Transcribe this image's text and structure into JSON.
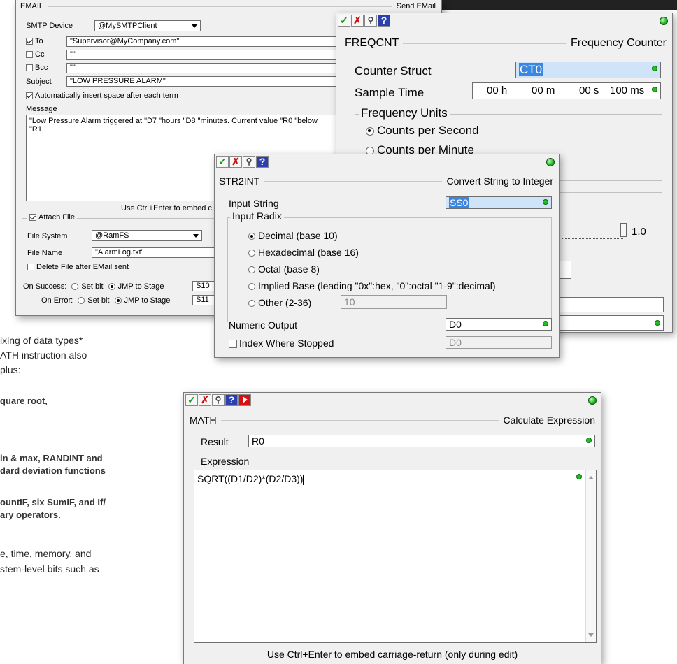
{
  "toolbar_icons": [
    "check-icon",
    "x-icon",
    "search-icon",
    "help-icon"
  ],
  "toolbar_glyphs": {
    "ok": "✓",
    "cancel": "✗",
    "find": "⚲",
    "help": "?"
  },
  "email": {
    "section_title": "EMAIL",
    "section_right": "Send EMail",
    "smtp_label": "SMTP Device",
    "smtp_value": "@MySMTPClient",
    "to_label": "To",
    "to_value": "\"Supervisor@MyCompany.com\"",
    "cc_label": "Cc",
    "cc_value": "\"\"",
    "bcc_label": "Bcc",
    "bcc_value": "\"\"",
    "subject_label": "Subject",
    "subject_value": "\"LOW PRESSURE ALARM\"",
    "auto_space_label": "Automatically insert space after each term",
    "message_label": "Message",
    "message_line1": "\"Low Pressure Alarm triggered at \"D7 \"hours \"D8 \"minutes. Current value \"R0 \"below",
    "message_line2": "\"R1",
    "hint": "Use Ctrl+Enter to embed c",
    "attach_label": "Attach File",
    "fs_label": "File System",
    "fs_value": "@RamFS",
    "fname_label": "File Name",
    "fname_value": "\"AlarmLog.txt\"",
    "delete_label": "Delete File after EMail sent",
    "success_label": "On Success:",
    "error_label": "On Error:",
    "setbit_label": "Set bit",
    "jmp_label": "JMP to Stage",
    "success_stage": "S10",
    "error_stage": "S11"
  },
  "freqcnt": {
    "name": "FREQCNT",
    "title": "Frequency Counter",
    "struct_label": "Counter Struct",
    "struct_value": "CT0",
    "sample_label": "Sample Time",
    "h": "00 h",
    "m": "00 m",
    "s": "00 s",
    "ms": "100 ms",
    "units_label": "Frequency Units",
    "unit_sec": "Counts per Second",
    "unit_min": "Counts per Minute",
    "slider_value": "1.0"
  },
  "str2int": {
    "name": "STR2INT",
    "title": "Convert String to Integer",
    "input_label": "Input String",
    "input_value": "SS0",
    "radix_label": "Input Radix",
    "r_dec": "Decimal (base 10)",
    "r_hex": "Hexadecimal (base 16)",
    "r_oct": "Octal (base 8)",
    "r_impl": "Implied Base (leading \"0x\":hex, \"0\":octal \"1-9\":decimal)",
    "r_other": "Other (2-36)",
    "other_value": "10",
    "output_label": "Numeric Output",
    "output_value": "D0",
    "index_label": "Index Where Stopped",
    "index_value": "D0"
  },
  "math": {
    "name": "MATH",
    "title": "Calculate Expression",
    "result_label": "Result",
    "result_value": "R0",
    "expr_label": "Expression",
    "expr_value": "SQRT((D1/D2)*(D2/D3))",
    "hint": "Use Ctrl+Enter to embed carriage-return (only during edit)"
  },
  "background_text": {
    "l1": "ixing of data types*",
    "l2": "ATH instruction also",
    "l3": "plus:",
    "l4": "quare root,",
    "l5": "in & max, RANDINT and",
    "l6": "dard deviation functions",
    "l7": "ountIF, six SumIF, and If/",
    "l8": "ary operators.",
    "l9": "e, time, memory, and",
    "l10": "stem-level bits such as"
  }
}
